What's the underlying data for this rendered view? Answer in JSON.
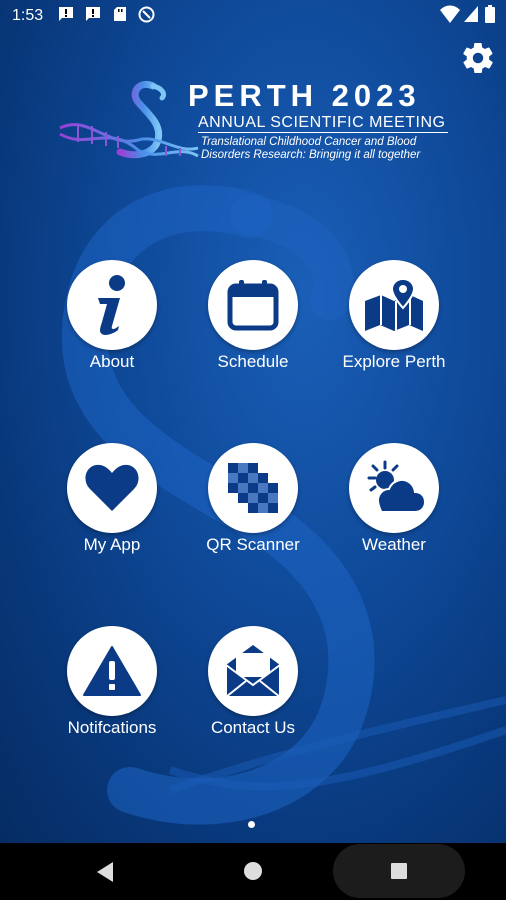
{
  "status_bar": {
    "time": "1:53"
  },
  "logo": {
    "title": "PERTH 2023",
    "subtitle": "ANNUAL SCIENTIFIC MEETING",
    "tagline_line1": "Translational Childhood Cancer and Blood",
    "tagline_line2": "Disorders Research: Bringing it all together"
  },
  "menu": {
    "about": "About",
    "schedule": "Schedule",
    "explore": "Explore Perth",
    "myapp": "My App",
    "qr": "QR Scanner",
    "weather": "Weather",
    "notifications": "Notifcations",
    "contact": "Contact Us"
  },
  "icons": {
    "about": "info-icon",
    "schedule": "calendar-icon",
    "explore": "map-pin-icon",
    "myapp": "heart-icon",
    "qr": "qr-code-icon",
    "weather": "weather-icon",
    "notifications": "warning-icon",
    "contact": "envelope-icon",
    "settings": "gear-icon"
  },
  "colors": {
    "icon": "#0b3b87",
    "background": "#0f4a9a",
    "navbar": "#000000"
  }
}
